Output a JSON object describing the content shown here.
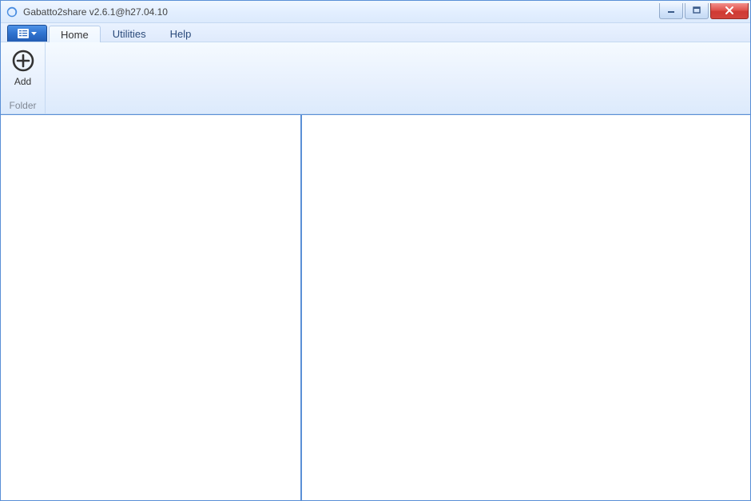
{
  "window": {
    "title": "Gabatto2share v2.6.1@h27.04.10"
  },
  "tabs": {
    "home": "Home",
    "utilities": "Utilities",
    "help": "Help"
  },
  "ribbon": {
    "add_label": "Add",
    "folder_group": "Folder"
  },
  "icons": {
    "app_menu": "app-menu",
    "minimize": "minimize",
    "maximize": "maximize",
    "close": "close",
    "circle_plus": "add"
  }
}
